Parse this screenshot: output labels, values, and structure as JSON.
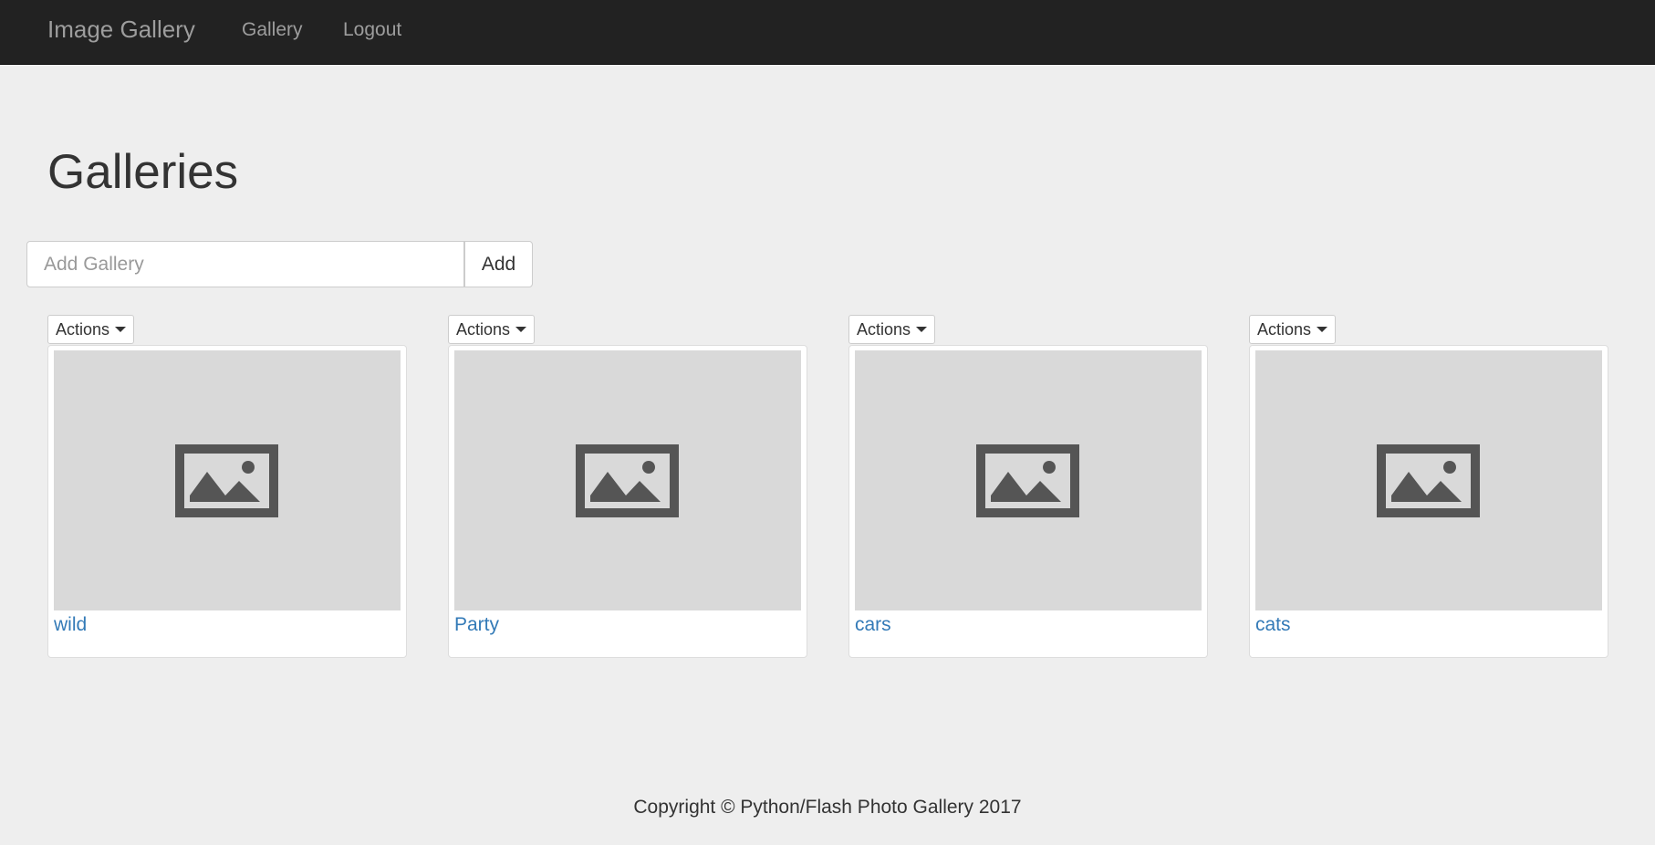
{
  "navbar": {
    "brand": "Image Gallery",
    "links": [
      {
        "label": "Gallery"
      },
      {
        "label": "Logout"
      }
    ]
  },
  "page": {
    "title": "Galleries"
  },
  "add_form": {
    "placeholder": "Add Gallery",
    "value": "",
    "button_label": "Add"
  },
  "galleries": [
    {
      "name": "wild",
      "actions_label": "Actions",
      "icon": "image-placeholder-icon"
    },
    {
      "name": "Party",
      "actions_label": "Actions",
      "icon": "image-placeholder-icon"
    },
    {
      "name": "cars",
      "actions_label": "Actions",
      "icon": "image-placeholder-icon"
    },
    {
      "name": "cats",
      "actions_label": "Actions",
      "icon": "image-placeholder-icon"
    }
  ],
  "footer": {
    "text": "Copyright © Python/Flash Photo Gallery 2017"
  },
  "colors": {
    "navbar_bg": "#222222",
    "navbar_text": "#9d9d9d",
    "page_bg": "#eeeeee",
    "link": "#337ab7",
    "thumb_placeholder_bg": "#d9d9d9",
    "icon_fill": "#555555"
  }
}
